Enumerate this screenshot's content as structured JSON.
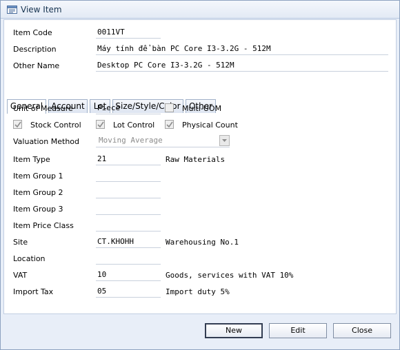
{
  "window": {
    "title": "View Item",
    "title_icon": "view-item-icon"
  },
  "header": {
    "item_code_label": "Item Code",
    "item_code": "0011VT",
    "description_label": "Description",
    "description": "Máy tính để bàn PC Core I3-3.2G - 512M",
    "other_name_label": "Other Name",
    "other_name": "Desktop PC Core I3-3.2G - 512M"
  },
  "tabs": [
    {
      "label": "General",
      "active": true
    },
    {
      "label": "Account",
      "active": false
    },
    {
      "label": "Lot",
      "active": false
    },
    {
      "label": "Size/Style/Color",
      "active": false
    },
    {
      "label": "Other",
      "active": false
    }
  ],
  "general": {
    "uom_label": "Unit of Measure",
    "uom": "Piece",
    "multi_uom_label": "Multi-UOM",
    "multi_uom_checked": false,
    "stock_control_label": "Stock Control",
    "stock_control_checked": true,
    "lot_control_label": "Lot Control",
    "lot_control_checked": true,
    "physical_count_label": "Physical Count",
    "physical_count_checked": true,
    "valuation_label": "Valuation Method",
    "valuation": "Moving Average",
    "item_type_label": "Item Type",
    "item_type": "21",
    "item_type_desc": "Raw Materials",
    "item_group1_label": "Item Group 1",
    "item_group1": "",
    "item_group2_label": "Item Group 2",
    "item_group2": "",
    "item_group3_label": "Item Group 3",
    "item_group3": "",
    "price_class_label": "Item Price Class",
    "price_class": "",
    "site_label": "Site",
    "site": "CT.KHOHH",
    "site_desc": "Warehousing No.1",
    "location_label": "Location",
    "location": "",
    "vat_label": "VAT",
    "vat": "10",
    "vat_desc": "Goods, services with VAT 10%",
    "import_tax_label": "Import Tax",
    "import_tax": "05",
    "import_tax_desc": "Import duty 5%"
  },
  "buttons": {
    "new": "New",
    "edit": "Edit",
    "close": "Close"
  },
  "colors": {
    "frame": "#e8eef8",
    "accent_border": "#8da2c0"
  }
}
